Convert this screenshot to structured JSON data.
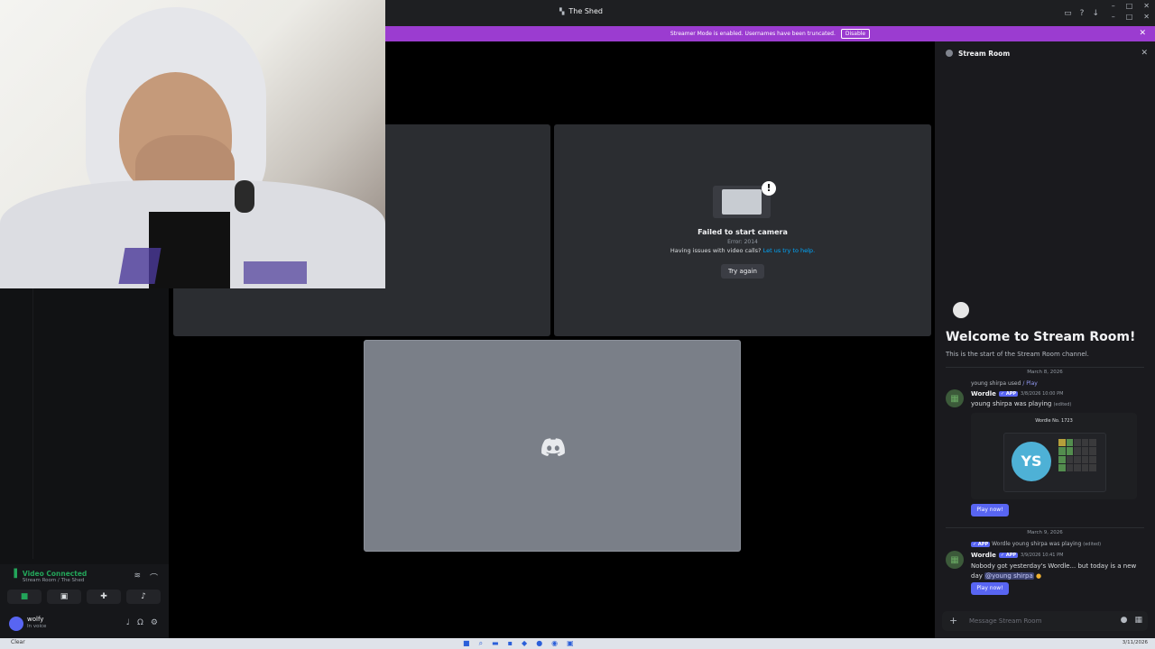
{
  "window": {
    "title": "The Shed"
  },
  "banner": {
    "message": "Streamer Mode is enabled. Usernames have been truncated.",
    "disable_label": "Disable"
  },
  "tiles": {
    "camera_error": {
      "title": "Failed to start camera",
      "code": "Error: 2014",
      "help_prefix": "Having issues with video calls?",
      "help_link": "Let us try to help.",
      "retry_label": "Try again"
    }
  },
  "voice": {
    "status": "Video Connected",
    "location": "Stream Room / The Shed"
  },
  "user": {
    "name": "wolfy",
    "status": "In voice"
  },
  "chat": {
    "channel_name": "Stream Room",
    "welcome_title": "Welcome to Stream Room!",
    "welcome_sub": "This is the start of the Stream Room channel.",
    "date1": "March 8, 2026",
    "reply1_user": "young shirpa used",
    "reply1_cmd": "/ Play",
    "msg1_author": "Wordle",
    "app_badge": "✓ APP",
    "msg1_time": "3/8/2026 10:00 PM",
    "msg1_text": "young shirpa was playing",
    "msg1_edited": "(edited)",
    "embed_caption": "Wordle No. 1723",
    "embed_initials": "YS",
    "play_label": "Play now!",
    "date2": "March 9, 2026",
    "reply2_text": "Wordle young shirpa was playing",
    "reply2_edited": "(edited)",
    "msg2_author": "Wordle",
    "msg2_time": "3/9/2026 10:41 PM",
    "msg2_text_line1": "Nobody got yesterday's Wordle... but today is a new",
    "msg2_text_line2_prefix": "day",
    "msg2_mention": "@young shirpa",
    "composer_placeholder": "Message Stream Room"
  },
  "taskbar": {
    "weather": "Clear",
    "date": "3/11/2026"
  },
  "colors": {
    "banner": "#9b3cd0",
    "accent": "#5865f2",
    "connected": "#23a55a",
    "link": "#00a8fc"
  }
}
